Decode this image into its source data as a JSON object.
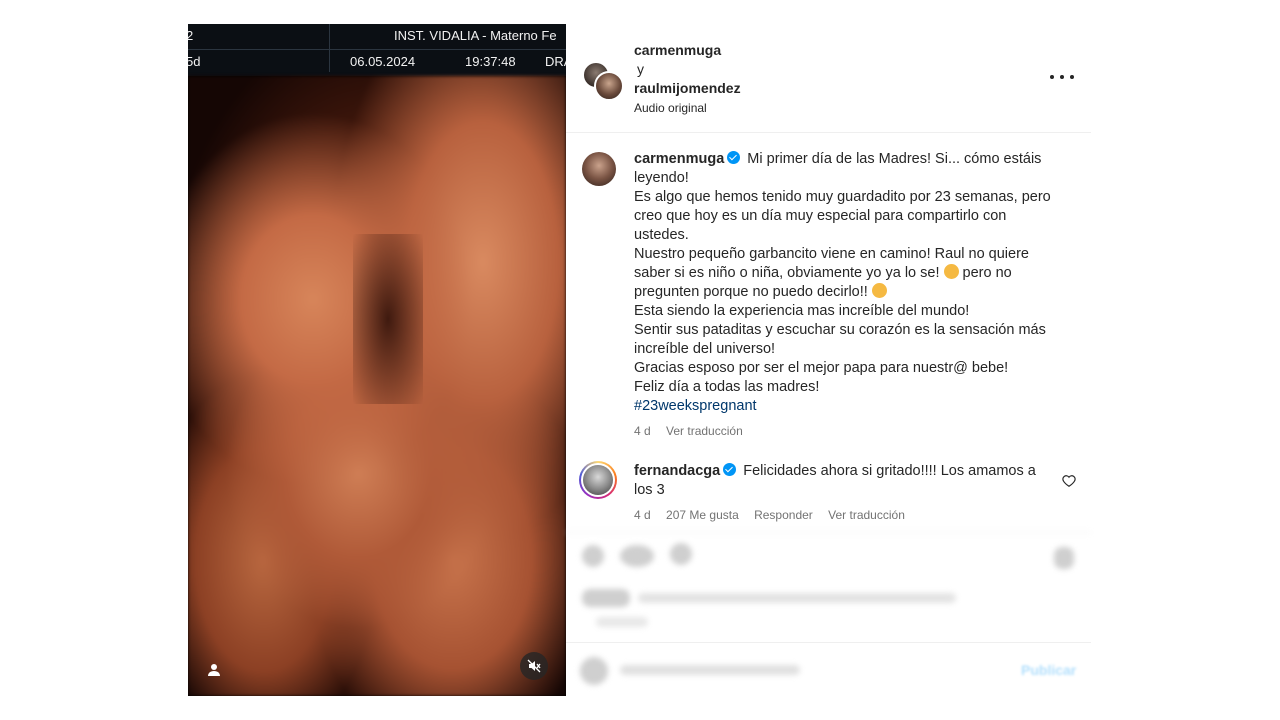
{
  "ultrasound": {
    "header_left_top": "2",
    "header_left_bottom": "5d",
    "institution": "INST. VIDALIA - Materno Fe",
    "date": "06.05.2024",
    "time": "19:37:48",
    "doctor": "DRA"
  },
  "media_controls": {
    "icons": [
      "user-tag-icon",
      "mute-icon"
    ]
  },
  "post_header": {
    "user1": "carmenmuga",
    "connector": "y",
    "user2": "raulmijomendez",
    "audio": "Audio original"
  },
  "caption": {
    "username": "carmenmuga",
    "lines": [
      "Mi primer día de las Madres! Si... cómo estáis leyendo!",
      "Es algo que hemos tenido muy guardadito por 23 semanas, pero creo que hoy es un día muy especial para compartirlo con ustedes.",
      "Nuestro pequeño garbancito viene en camino! Raul no quiere saber si es niño o niña, obviamente yo ya lo se!",
      "pero no pregunten porque no puedo decirlo!!",
      "Esta siendo la experiencia mas increíble del mundo!",
      "Sentir sus pataditas y escuchar su corazón es la sensación más increíble del universo!",
      "Gracias esposo por ser el mejor papa para nuestr@ bebe!",
      "Feliz día a todas las madres!"
    ],
    "hashtag": "#23weekspregnant",
    "time": "4 d",
    "translate": "Ver traducción"
  },
  "comment": {
    "username": "fernandacga",
    "text": "Felicidades ahora si gritado!!!! Los amamos a los 3",
    "time": "4 d",
    "likes": "207 Me gusta",
    "reply": "Responder",
    "translate": "Ver traducción"
  },
  "footer": {
    "publish": "Publicar"
  }
}
